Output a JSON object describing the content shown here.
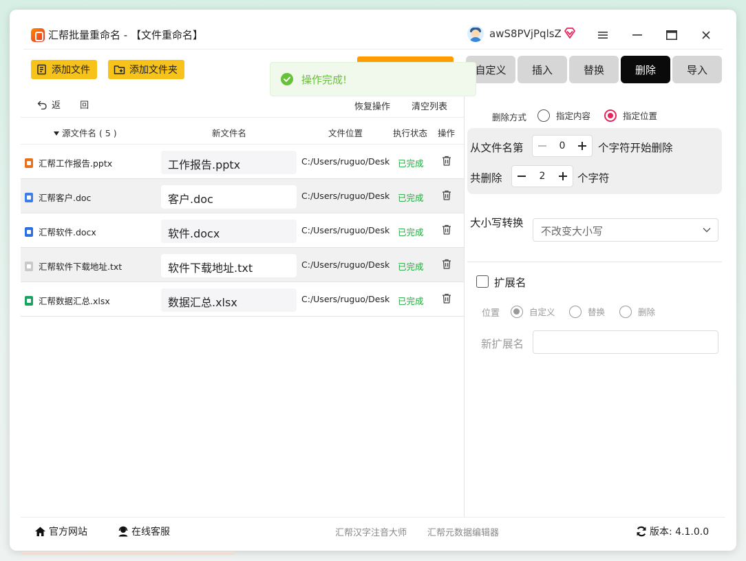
{
  "window": {
    "title": "汇帮批量重命名 - 【文件重命名】",
    "username": "awS8PVjPqlsZ"
  },
  "toolbar": {
    "add_file": "添加文件",
    "add_folder": "添加文件夹"
  },
  "toast": {
    "message": "操作完成!",
    "accent": "#67c23a"
  },
  "tabs": [
    {
      "label": "自定义",
      "active": false
    },
    {
      "label": "插入",
      "active": false
    },
    {
      "label": "替换",
      "active": false
    },
    {
      "label": "删除",
      "active": true
    },
    {
      "label": "导入",
      "active": false
    }
  ],
  "list_actions": {
    "back": "返 回",
    "restore": "恢复操作",
    "clear": "清空列表"
  },
  "table": {
    "headers": {
      "source": "源文件名 ( 5 )",
      "new_name": "新文件名",
      "location": "文件位置",
      "status": "执行状态",
      "action": "操作"
    },
    "rows": [
      {
        "source": "汇帮工作报告.pptx",
        "new_name": "工作报告.pptx",
        "location": "C:/Users/ruguo/Desktop",
        "status": "已完成",
        "icon": "pptx-icon",
        "icon_color": "#e8701a"
      },
      {
        "source": "汇帮客户.doc",
        "new_name": "客户.doc",
        "location": "C:/Users/ruguo/Desktop",
        "status": "已完成",
        "icon": "doc-icon",
        "icon_color": "#3b7de9"
      },
      {
        "source": "汇帮软件.docx",
        "new_name": "软件.docx",
        "location": "C:/Users/ruguo/Desktop",
        "status": "已完成",
        "icon": "docx-icon",
        "icon_color": "#2b6fe0"
      },
      {
        "source": "汇帮软件下载地址.txt",
        "new_name": "软件下载地址.txt",
        "location": "C:/Users/ruguo/Desktop",
        "status": "已完成",
        "icon": "txt-icon",
        "icon_color": "#c9c9c9"
      },
      {
        "source": "汇帮数据汇总.xlsx",
        "new_name": "数据汇总.xlsx",
        "location": "C:/Users/ruguo/Desktop",
        "status": "已完成",
        "icon": "xlsx-icon",
        "icon_color": "#1aa260"
      }
    ]
  },
  "delete_panel": {
    "mode_label": "删除方式",
    "mode_content": "指定内容",
    "mode_position": "指定位置",
    "from_label": "从文件名第",
    "from_value": "0",
    "from_suffix": "个字符开始删除",
    "count_label": "共删除",
    "count_value": "2",
    "count_suffix": "个字符",
    "case_label": "大小写转换",
    "case_value": "不改变大小写",
    "ext_label": "扩展名",
    "pos_label": "位置",
    "pos_custom": "自定义",
    "pos_replace": "替换",
    "pos_delete": "删除",
    "new_ext_label": "新扩展名",
    "new_ext_value": ""
  },
  "footer": {
    "website": "官方网站",
    "support": "在线客服",
    "link1": "汇帮汉字注音大师",
    "link2": "汇帮元数据编辑器",
    "version": "版本:  4.1.0.0"
  },
  "colors": {
    "accent_yellow": "#f7c21a",
    "active_radio": "#e8245a",
    "status_done": "#1faa3c",
    "active_tab": "#0a0a0a"
  }
}
